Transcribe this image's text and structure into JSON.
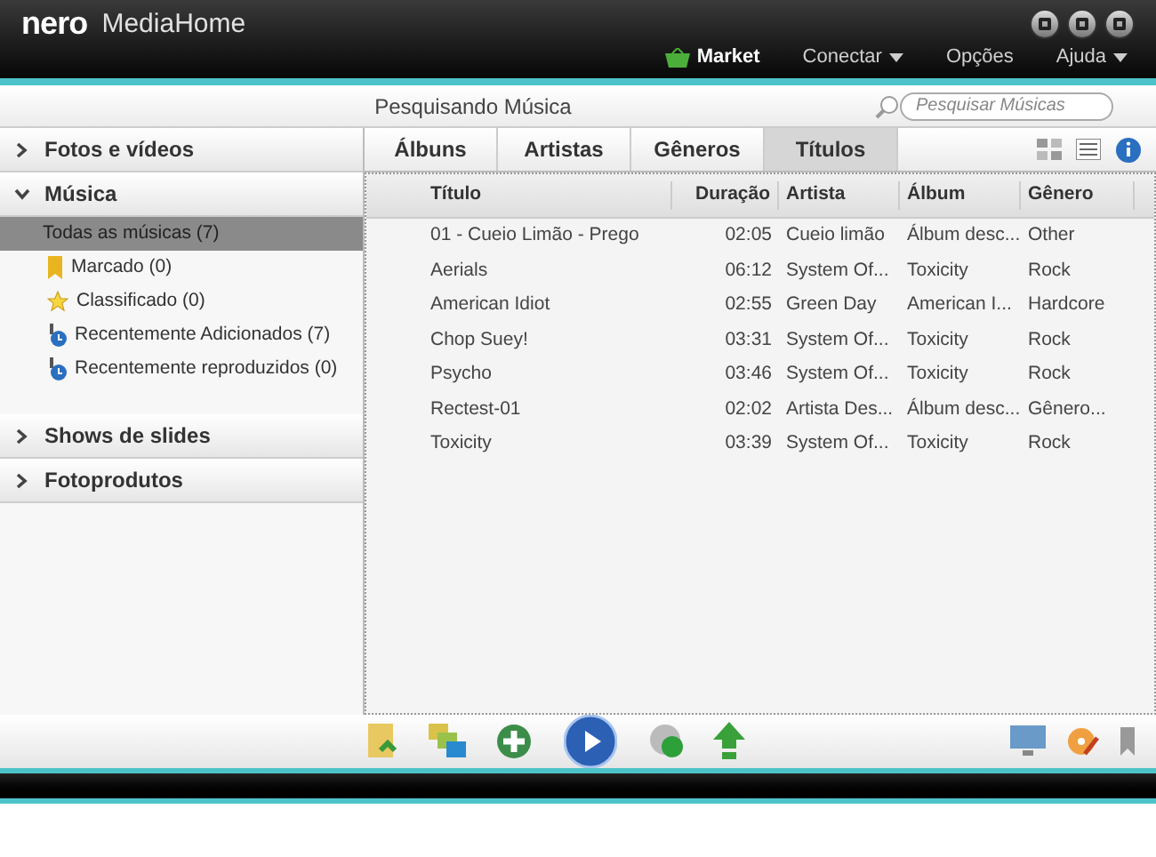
{
  "window": {
    "logo": "nero",
    "title": "MediaHome"
  },
  "menu": [
    {
      "label": "Market",
      "kind": "market"
    },
    {
      "label": "Conectar",
      "kind": "dropdown"
    },
    {
      "label": "Opções",
      "kind": "plain"
    },
    {
      "label": "Ajuda",
      "kind": "dropdown"
    }
  ],
  "search": {
    "heading": "Pesquisando Música",
    "placeholder": "Pesquisar Músicas"
  },
  "sidebar": [
    {
      "label": "Fotos e vídeos",
      "expanded": false
    },
    {
      "label": "Música",
      "expanded": true,
      "items": [
        {
          "label": "Todas as músicas (7)",
          "kind": "all",
          "selected": true
        },
        {
          "label": "Marcado (0)",
          "kind": "bookmark",
          "selected": false
        },
        {
          "label": "Classificado (0)",
          "kind": "star",
          "selected": false
        },
        {
          "label": "Recentemente Adicionados (7)",
          "kind": "recent",
          "selected": false
        },
        {
          "label": "Recentemente reproduzidos (0)",
          "kind": "recent",
          "selected": false
        }
      ]
    },
    {
      "label": "Shows de slides",
      "expanded": false
    },
    {
      "label": "Fotoprodutos",
      "expanded": false
    }
  ],
  "tabs": [
    {
      "label": "Álbuns",
      "selected": false
    },
    {
      "label": "Artistas",
      "selected": false
    },
    {
      "label": "Gêneros",
      "selected": false
    },
    {
      "label": "Títulos",
      "selected": true
    }
  ],
  "table": {
    "columns": [
      "Título",
      "Duração",
      "Artista",
      "Álbum",
      "Gênero"
    ],
    "rows": [
      [
        "01 - Cueio Limão - Prego",
        "02:05",
        "Cueio limão",
        "Álbum desc...",
        "Other"
      ],
      [
        "Aerials",
        "06:12",
        "System Of...",
        "Toxicity",
        "Rock"
      ],
      [
        "American Idiot",
        "02:55",
        "Green Day",
        "American I...",
        "Hardcore"
      ],
      [
        "Chop Suey!",
        "03:31",
        "System Of...",
        "Toxicity",
        "Rock"
      ],
      [
        "Psycho",
        "03:46",
        "System Of...",
        "Toxicity",
        "Rock"
      ],
      [
        "Rectest-01",
        "02:02",
        "Artista Des...",
        "Álbum desc...",
        "Gênero..."
      ],
      [
        "Toxicity",
        "03:39",
        "System Of...",
        "Toxicity",
        "Rock"
      ]
    ]
  }
}
